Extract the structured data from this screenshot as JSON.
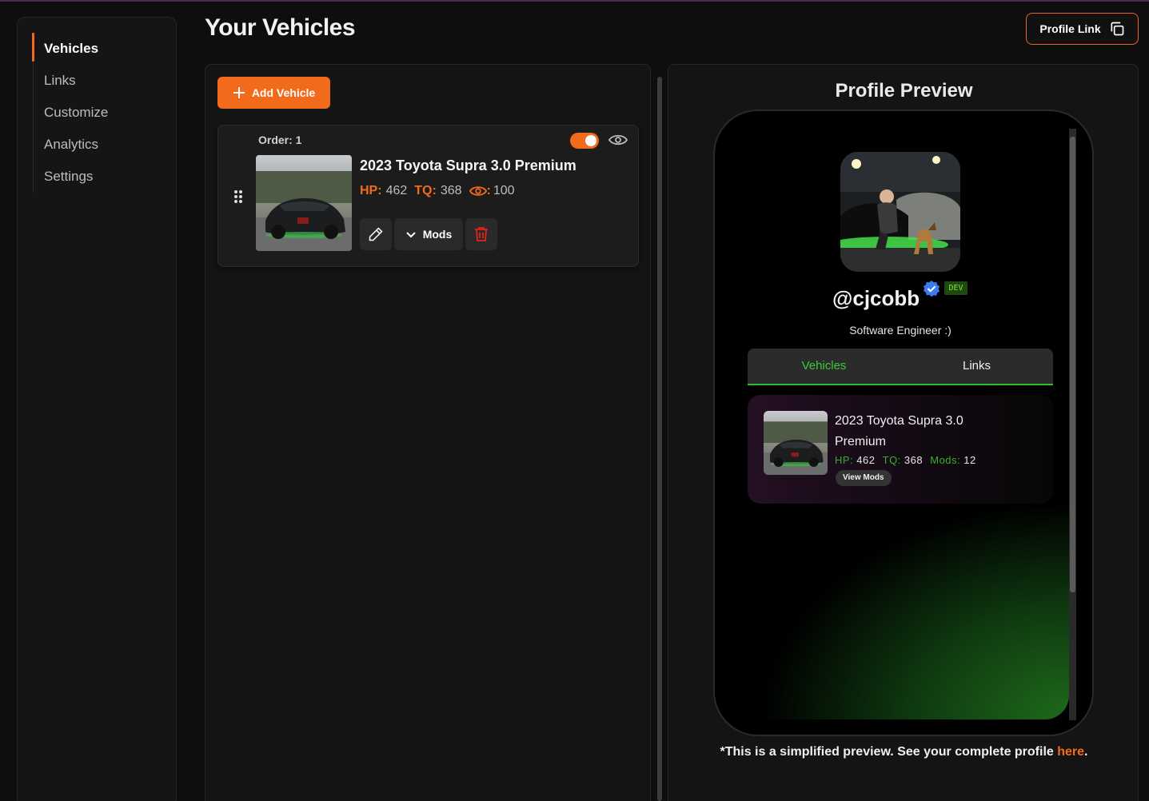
{
  "colors": {
    "accent": "#f26b1d",
    "preview_green": "#3cc93a"
  },
  "sidebar": {
    "items": [
      {
        "label": "Vehicles",
        "active": true
      },
      {
        "label": "Links",
        "active": false
      },
      {
        "label": "Customize",
        "active": false
      },
      {
        "label": "Analytics",
        "active": false
      },
      {
        "label": "Settings",
        "active": false
      }
    ]
  },
  "header": {
    "title": "Your Vehicles",
    "profile_link_label": "Profile Link",
    "profile_link_icon": "copy-icon"
  },
  "vehicles": {
    "add_label": "Add Vehicle",
    "add_icon": "plus-icon",
    "items": [
      {
        "order_label": "Order: 1",
        "title": "2023 Toyota Supra 3.0 Premium",
        "hp_label": "HP:",
        "hp": "462",
        "tq_label": "TQ:",
        "tq": "368",
        "views_label": ":",
        "views": "100",
        "visible": true,
        "mods_label": "Mods"
      }
    ]
  },
  "preview": {
    "title": "Profile Preview",
    "handle": "@cjcobb",
    "badge": "DEV",
    "bio": "Software Engineer :)",
    "tabs": [
      {
        "label": "Vehicles",
        "active": true
      },
      {
        "label": "Links",
        "active": false
      }
    ],
    "card": {
      "title": "2023 Toyota Supra 3.0 Premium",
      "hp_label": "HP:",
      "hp": "462",
      "tq_label": "TQ:",
      "tq": "368",
      "mods_label": "Mods:",
      "mods": "12",
      "view_mods_label": "View Mods"
    },
    "footnote_prefix": "*This is a simplified preview. See your complete profile ",
    "footnote_link": "here",
    "footnote_suffix": "."
  }
}
